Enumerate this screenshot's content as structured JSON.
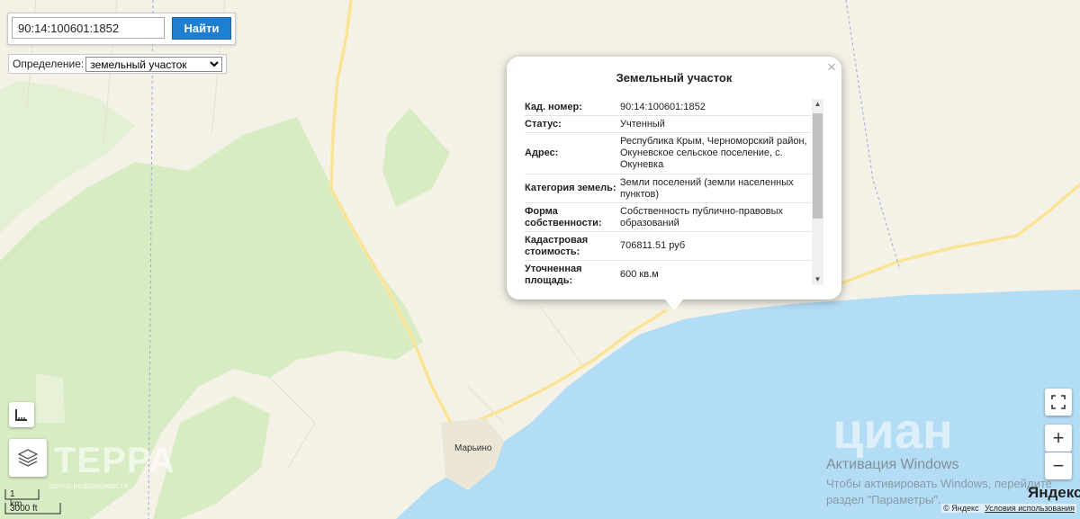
{
  "search": {
    "value": "90:14:100601:1852",
    "button": "Найти"
  },
  "definition": {
    "label": "Определение:",
    "selected": "земельный участок"
  },
  "popup": {
    "title": "Земельный участок",
    "close": "×",
    "rows": [
      {
        "key": "Кад. номер:",
        "value": "90:14:100601:1852"
      },
      {
        "key": "Статус:",
        "value": "Учтенный"
      },
      {
        "key": "Адрес:",
        "value": "Республика Крым, Черноморский район, Окуневское сельское поселение, с. Окуневка"
      },
      {
        "key": "Категория земель:",
        "value": "Земли поселений (земли населенных пунктов)"
      },
      {
        "key": "Форма собственности:",
        "value": "Собственность публично-правовых образований"
      },
      {
        "key": "Кадастровая стоимость:",
        "value": "706811.51 руб"
      },
      {
        "key": "Уточненная площадь:",
        "value": "600 кв.м"
      }
    ]
  },
  "map": {
    "place_label": "Марьино",
    "scale_km": "1 km",
    "scale_ft": "3000 ft",
    "logo": "Яндекс",
    "copyright": "© Яндекс",
    "terms": "Условия использования"
  },
  "watermarks": {
    "terra": "ТЕРРА",
    "terra_sub": "центр недвижимости",
    "cian": "циан",
    "activation_title": "Активация Windows",
    "activation_line1": "Чтобы активировать Windows, перейдите",
    "activation_line2": "раздел \"Параметры\"."
  },
  "controls": {
    "zoom_in": "+",
    "zoom_out": "−"
  },
  "colors": {
    "land": "#f4f1e6",
    "forest": "#d8ecc4",
    "water": "#b3dcf5",
    "road": "#fbe9a8",
    "accent": "#1f7fd0"
  }
}
